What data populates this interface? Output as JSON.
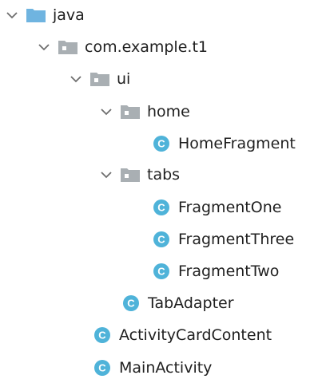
{
  "tree": {
    "java": {
      "label": "java",
      "icon": "source-folder-icon"
    },
    "com_example_t1": {
      "label": "com.example.t1",
      "icon": "package-folder-icon"
    },
    "ui": {
      "label": "ui",
      "icon": "package-folder-icon"
    },
    "home": {
      "label": "home",
      "icon": "package-folder-icon"
    },
    "home_fragment": {
      "label": "HomeFragment",
      "icon": "class-icon"
    },
    "tabs": {
      "label": "tabs",
      "icon": "package-folder-icon"
    },
    "fragment_one": {
      "label": "FragmentOne",
      "icon": "class-icon"
    },
    "fragment_three": {
      "label": "FragmentThree",
      "icon": "class-icon"
    },
    "fragment_two": {
      "label": "FragmentTwo",
      "icon": "class-icon"
    },
    "tab_adapter": {
      "label": "TabAdapter",
      "icon": "class-icon"
    },
    "activity_card_content": {
      "label": "ActivityCardContent",
      "icon": "class-icon"
    },
    "main_activity": {
      "label": "MainActivity",
      "icon": "class-icon"
    }
  },
  "colors": {
    "source_folder": "#6FB4E0",
    "package_folder": "#A9AFB3",
    "class_icon_fill": "#4FB3D9",
    "class_icon_letter": "#ffffff",
    "chevron": "#6E6E6E",
    "text": "#1f1f1f"
  },
  "icons": {
    "class_letter": "C"
  }
}
